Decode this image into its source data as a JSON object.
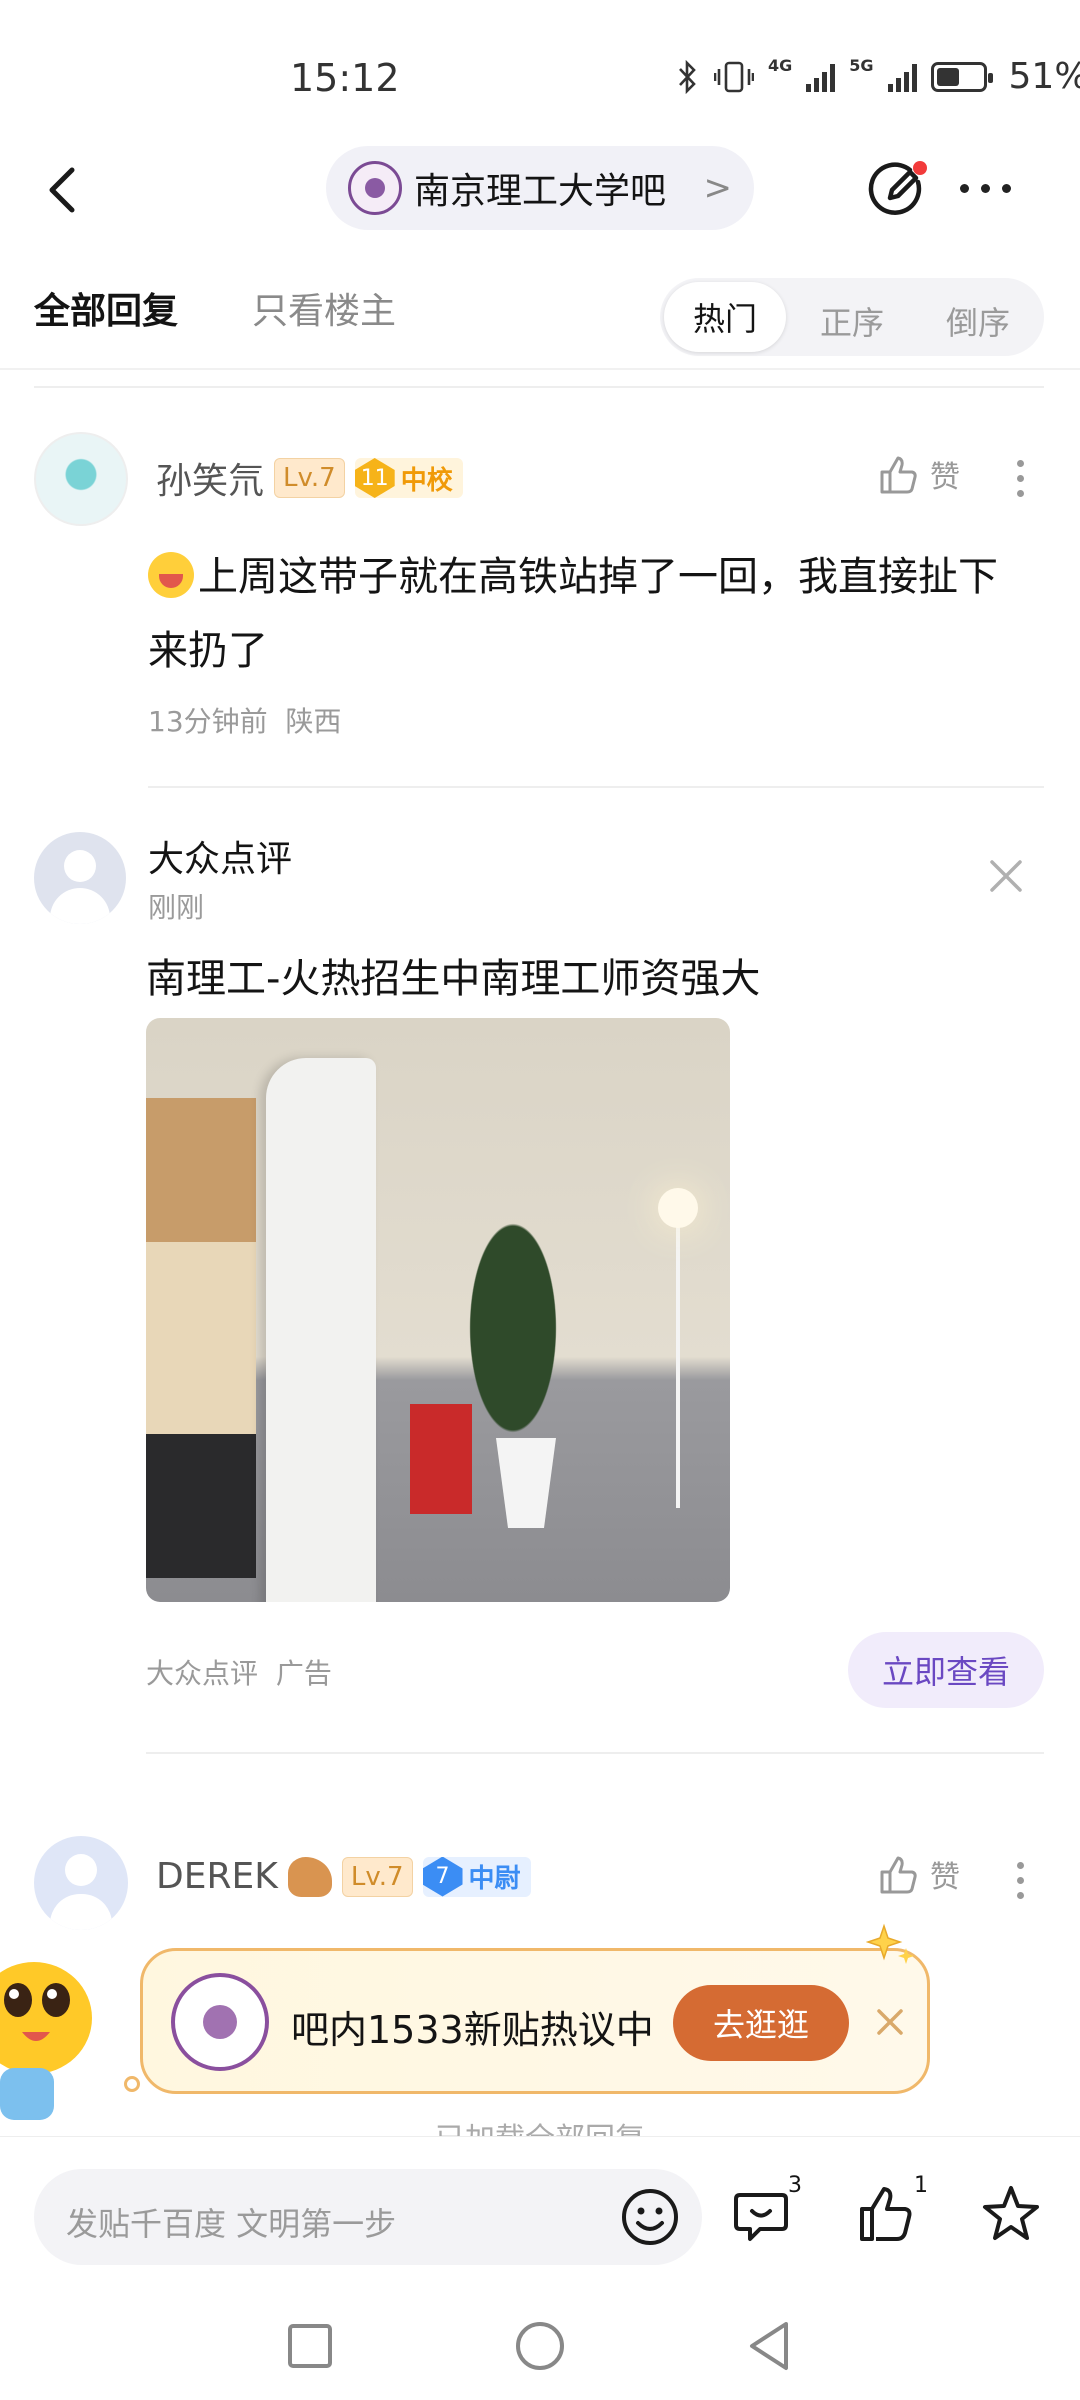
{
  "status_bar": {
    "time": "15:12",
    "network_1": "4G",
    "network_2": "5G",
    "battery_level": 0.51,
    "battery_text": "51%"
  },
  "nav": {
    "forum_name": "南京理工大学吧",
    "chevron": ">"
  },
  "filter_tabs": {
    "all": "全部回复",
    "op_only": "只看楼主",
    "sort_hot": "热门",
    "sort_asc": "正序",
    "sort_desc": "倒序"
  },
  "reply1": {
    "username": "孙笑氘",
    "level": "Lv.7",
    "rank_num": "11",
    "rank_label": "中校",
    "like_label": "赞",
    "text": "上周这带子就在高铁站掉了一回，我直接扯下来扔了",
    "time": "13分钟前",
    "location": "陕西"
  },
  "ad": {
    "name": "大众点评",
    "time": "刚刚",
    "title": "南理工-火热招生中南理工师资强大",
    "source": "大众点评",
    "ad_label": "广告",
    "cta": "立即查看"
  },
  "reply2": {
    "username": "DEREK",
    "level": "Lv.7",
    "rank_num": "7",
    "rank_label": "中尉",
    "like_label": "赞"
  },
  "popup": {
    "text": "吧内1533新贴热议中",
    "button": "去逛逛"
  },
  "loaded_text": "已加载全部回复",
  "bottom_bar": {
    "placeholder": "发贴千百度 文明第一步",
    "comment_count": "3",
    "like_count": "1"
  },
  "colors": {
    "accent_orange": "#d56b33",
    "cta_purple": "#6a48c2",
    "rank_gold": "#f6b319",
    "rank_blue": "#3b8df4",
    "notification_red": "#f23b3b"
  }
}
